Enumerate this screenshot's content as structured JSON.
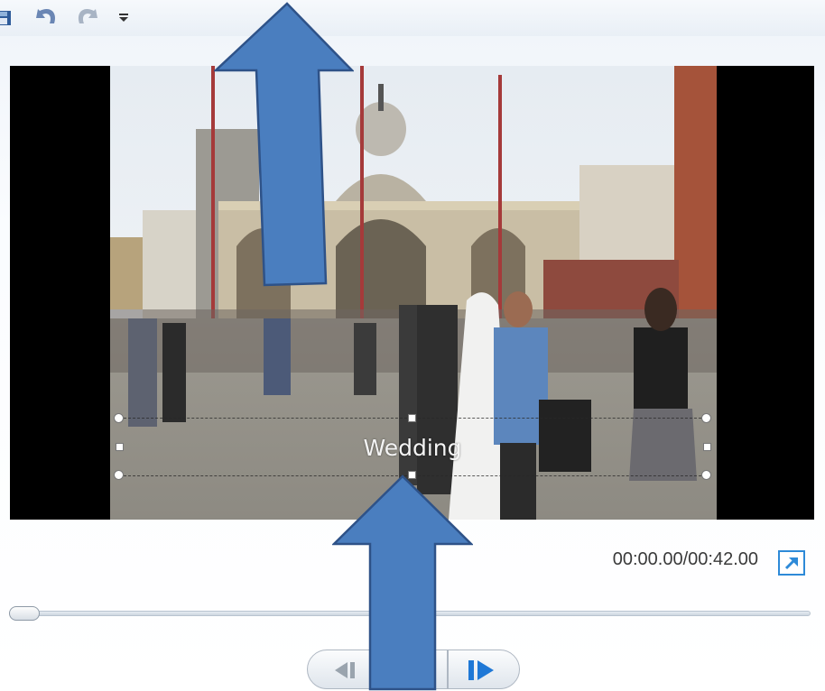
{
  "toolbar": {
    "icons": [
      "save-icon",
      "undo-icon",
      "redo-icon",
      "customize-toolbar-icon"
    ]
  },
  "preview": {
    "caption": "Wedding",
    "time_readout": "00:00.00/00:42.00",
    "seek_position": 0.0
  },
  "playback": {
    "icons": [
      "previous-frame-icon",
      "play-icon",
      "next-frame-icon"
    ]
  },
  "colors": {
    "annotation_arrow": "#4a7ebf",
    "accent": "#2e8ad8"
  }
}
